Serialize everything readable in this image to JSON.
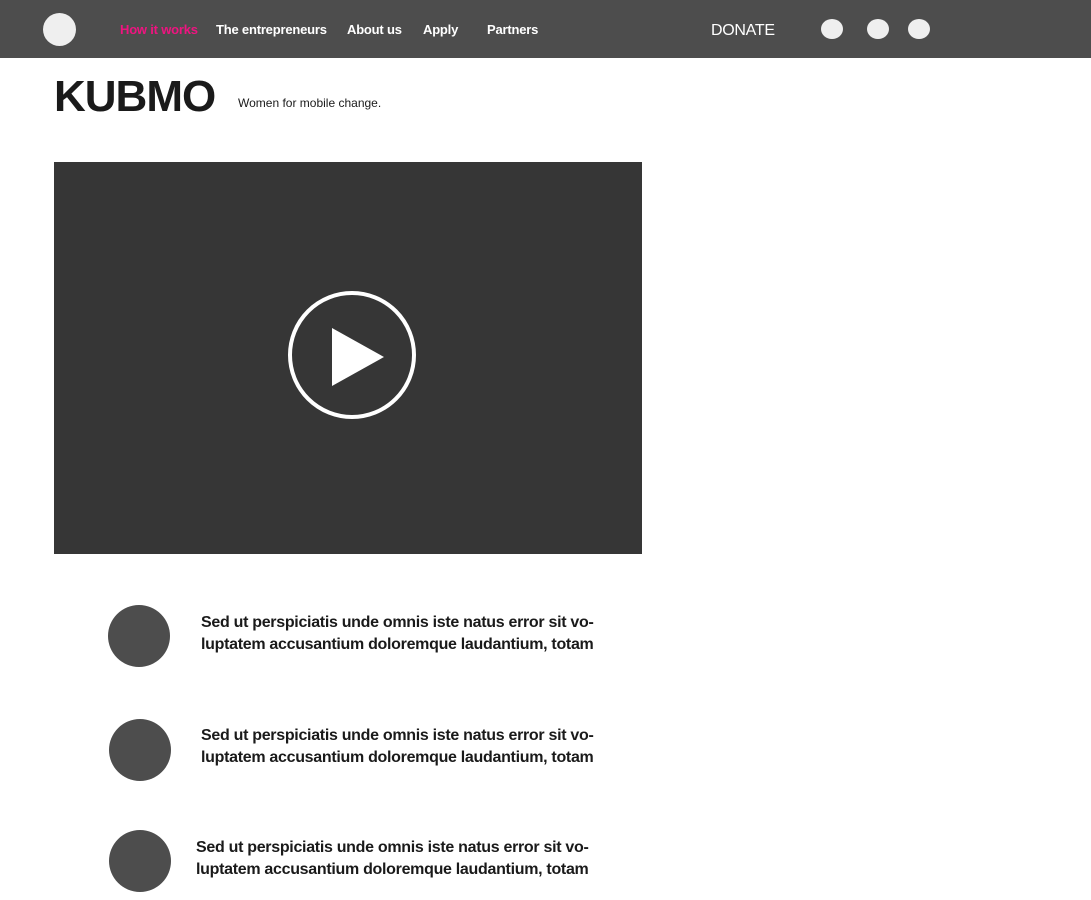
{
  "header": {
    "logo_icon": "circle-logo",
    "nav": [
      {
        "label": "How it works",
        "active": true
      },
      {
        "label": "The entrepreneurs",
        "active": false
      },
      {
        "label": "About us",
        "active": false
      },
      {
        "label": "Apply",
        "active": false
      },
      {
        "label": "Partners",
        "active": false
      }
    ],
    "donate_label": "DONATE",
    "social_icons": [
      "social-icon",
      "social-icon",
      "social-icon"
    ]
  },
  "brand": {
    "title": "KUBMO",
    "tagline": "Women for mobile change."
  },
  "video": {
    "play_icon": "play-icon"
  },
  "features": [
    {
      "line1": "Sed ut perspiciatis unde omnis iste natus error sit vo-",
      "line2": "luptatem accusantium doloremque laudantium, totam"
    },
    {
      "line1": "Sed ut perspiciatis unde omnis iste natus error sit vo-",
      "line2": "luptatem accusantium doloremque laudantium, totam"
    },
    {
      "line1": "Sed ut perspiciatis unde omnis iste natus error sit vo-",
      "line2": "luptatem accusantium doloremque laudantium, totam"
    }
  ],
  "colors": {
    "header_bg": "#4d4d4d",
    "accent": "#ee1480",
    "video_bg": "#363636",
    "placeholder": "#efefef"
  }
}
